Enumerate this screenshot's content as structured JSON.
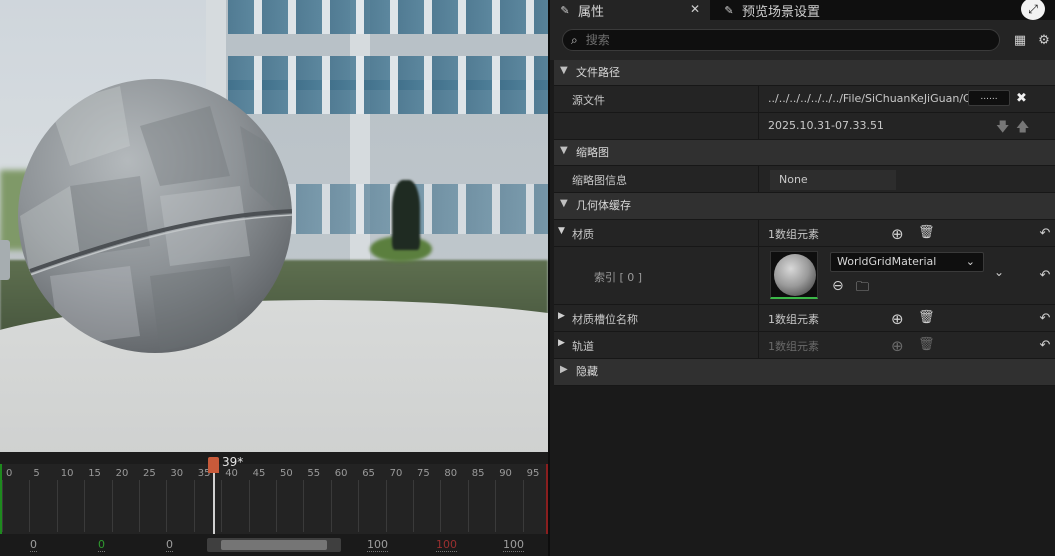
{
  "viewport": {
    "timeline": {
      "playhead_label": "39*",
      "ticks": [
        "0",
        "5",
        "10",
        "15",
        "20",
        "25",
        "30",
        "35",
        "40",
        "45",
        "50",
        "55",
        "60",
        "65",
        "70",
        "75",
        "80",
        "85",
        "90",
        "95"
      ],
      "range_values": [
        {
          "text": "0",
          "color": "#9e9e9e"
        },
        {
          "text": "0",
          "color": "#2f9a2f"
        },
        {
          "text": "0",
          "color": "#9e9e9e"
        },
        {
          "text": "100",
          "color": "#9e9e9e"
        },
        {
          "text": "100",
          "color": "#9a2f2f"
        },
        {
          "text": "100",
          "color": "#9e9e9e"
        }
      ]
    }
  },
  "panel": {
    "tabs": {
      "details": "属性",
      "preview_settings": "预览场景设置"
    },
    "search": {
      "placeholder": "搜索"
    },
    "sections": {
      "file_path": "文件路径",
      "thumbnail": "缩略图",
      "geometry_cache": "几何体缓存",
      "hidden": "隐藏"
    },
    "source_file": {
      "label": "源文件",
      "path": "../../../../../../../File/SiChuanKeJiGuan/C",
      "browse": "......",
      "timestamp": "2025.10.31-07.33.51"
    },
    "thumbnail_info": {
      "label": "缩略图信息",
      "value": "None"
    },
    "materials": {
      "label": "材质",
      "count": "1数组元素",
      "index_label": "索引 [ 0 ]",
      "selected_material": "WorldGridMaterial"
    },
    "material_slot_names": {
      "label": "材质槽位名称",
      "count": "1数组元素"
    },
    "tracks": {
      "label": "轨道",
      "count": "1数组元素"
    }
  }
}
